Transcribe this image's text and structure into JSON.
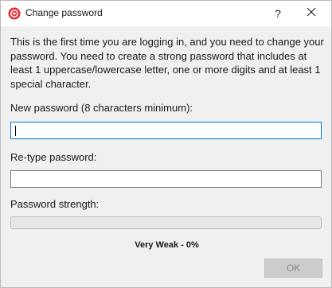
{
  "window": {
    "title": "Change password",
    "help_glyph": "?",
    "app_icon": "red-circle-icon",
    "close_icon": "close-icon"
  },
  "intro_text": "This is the first time you are logging in, and you need to change your password. You need to create a strong password that includes at least 1 uppercase/lowercase letter, one or more digits and at least 1 special character.",
  "new_password": {
    "label": "New password (8 characters minimum):",
    "value": ""
  },
  "retype_password": {
    "label": "Re-type password:",
    "value": ""
  },
  "strength": {
    "label": "Password strength:",
    "percent": 0,
    "status": "Very Weak - 0%"
  },
  "ok_button": {
    "label": "OK",
    "enabled": false
  },
  "colors": {
    "focus_border": "#0078d7",
    "app_icon": "#e8262b"
  }
}
